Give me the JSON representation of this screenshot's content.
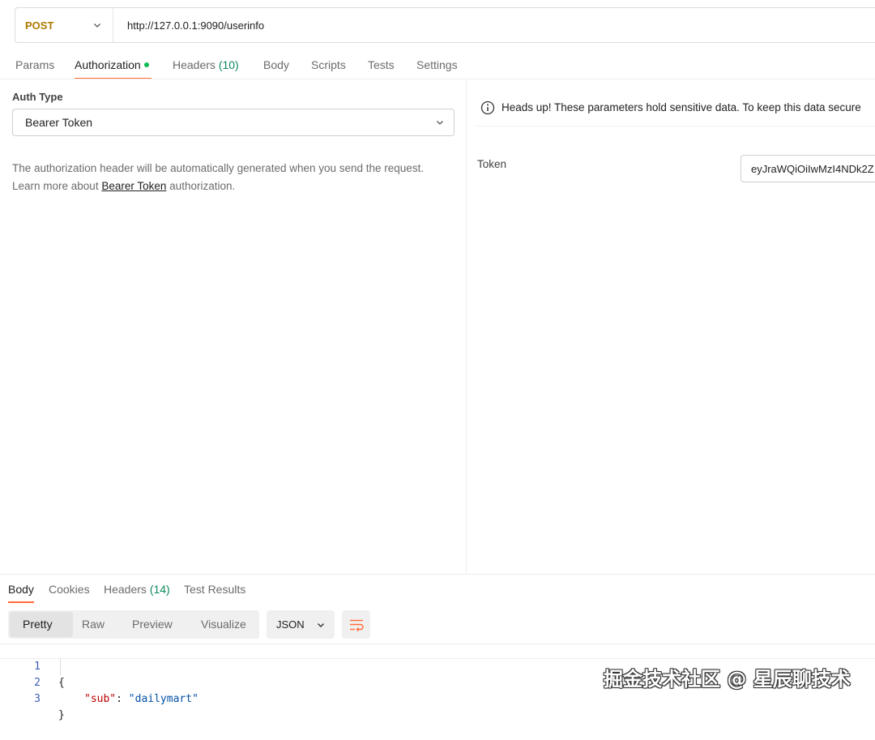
{
  "request": {
    "method": "POST",
    "url": "http://127.0.0.1:9090/userinfo"
  },
  "request_tabs": [
    {
      "label": "Params"
    },
    {
      "label": "Authorization"
    },
    {
      "label": "Headers",
      "count": "(10)"
    },
    {
      "label": "Body"
    },
    {
      "label": "Scripts"
    },
    {
      "label": "Tests"
    },
    {
      "label": "Settings"
    }
  ],
  "auth": {
    "type_label": "Auth Type",
    "type_value": "Bearer Token",
    "desc_line1": "The authorization header will be automatically generated when you send the request.",
    "desc_prefix": "Learn more about",
    "desc_link": "Bearer Token",
    "desc_suffix": "authorization.",
    "warning": "Heads up! These parameters hold sensitive data. To keep this data secure",
    "token_label": "Token",
    "token_value": "eyJraWQiOiIwMzI4NDk2Z"
  },
  "response_tabs": [
    {
      "label": "Body"
    },
    {
      "label": "Cookies"
    },
    {
      "label": "Headers",
      "count": "(14)"
    },
    {
      "label": "Test Results"
    }
  ],
  "view_modes": [
    "Pretty",
    "Raw",
    "Preview",
    "Visualize"
  ],
  "format": "JSON",
  "code": {
    "line_numbers": [
      "1",
      "2",
      "3"
    ],
    "open_brace": "{",
    "key": "\"sub\"",
    "colon": ": ",
    "value": "\"dailymart\"",
    "close_brace": "}"
  },
  "watermark": "掘金技术社区 @ 星辰聊技术",
  "colors": {
    "method": "#ad7a03",
    "accent": "#ff6c37",
    "active_dot": "#0cbb52",
    "count": "#0b8a5b"
  }
}
